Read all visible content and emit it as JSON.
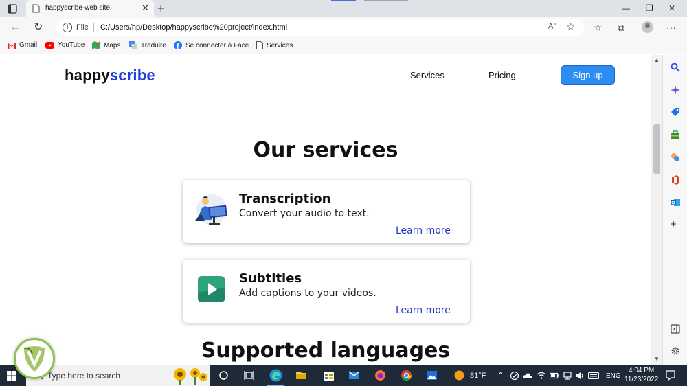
{
  "browser": {
    "tab_title": "happyscribe-web site",
    "tab_close_icon": "close-icon",
    "new_tab_icon": "plus-icon",
    "window_controls": [
      "minimize-icon",
      "restore-icon",
      "close-icon"
    ],
    "address": {
      "scheme_label": "File",
      "url": "C:/Users/hp/Desktop/happyscribe%20project/index.html"
    },
    "bookmarks": [
      {
        "label": "Gmail",
        "icon": "gmail-icon",
        "color": "#d93025"
      },
      {
        "label": "YouTube",
        "icon": "youtube-icon",
        "color": "#ff0000"
      },
      {
        "label": "Maps",
        "icon": "maps-icon",
        "color": "#34a853"
      },
      {
        "label": "Traduire",
        "icon": "translate-icon",
        "color": "#4285f4"
      },
      {
        "label": "Se connecter à Face...",
        "icon": "facebook-icon",
        "color": "#1877f2"
      },
      {
        "label": "Services",
        "icon": "page-icon",
        "color": "#555555"
      }
    ]
  },
  "site": {
    "logo_part1": "happy",
    "logo_part2": "scribe",
    "nav": {
      "services": "Services",
      "pricing": "Pricing",
      "signup": "Sign up"
    },
    "services_heading": "Our services",
    "cards": [
      {
        "title": "Transcription",
        "description": "Convert your audio to text.",
        "link": "Learn more",
        "icon": "person-laptop-illustration"
      },
      {
        "title": "Subtitles",
        "description": "Add captions to your videos.",
        "link": "Learn more",
        "icon": "video-play-icon"
      }
    ],
    "languages_heading": "Supported languages",
    "colors": {
      "accent": "#1f3de0",
      "button": "#2d8cf0",
      "link": "#1f35c9"
    }
  },
  "taskbar": {
    "search_placeholder": "Type here to search",
    "weather": "81°F",
    "language": "ENG",
    "time": "4:04 PM",
    "date": "11/23/2022"
  }
}
